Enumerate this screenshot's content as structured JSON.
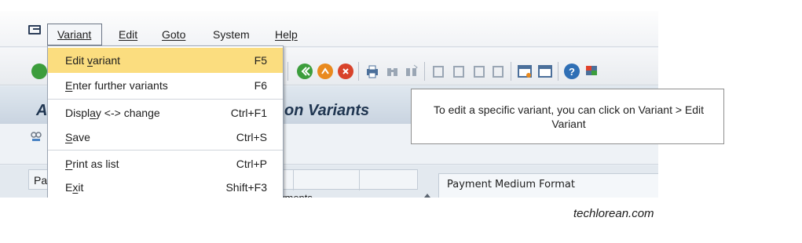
{
  "menubar": {
    "items": [
      {
        "label": "Variant"
      },
      {
        "label": "Edit"
      },
      {
        "label": "Goto"
      },
      {
        "label": "System"
      },
      {
        "label": "Help"
      }
    ]
  },
  "dropdown": {
    "items": [
      {
        "label_pre": "Edit ",
        "label_u": "v",
        "label_post": "ariant",
        "shortcut": "F5",
        "highlighted": true
      },
      {
        "label_pre": "",
        "label_u": "E",
        "label_post": "nter further variants",
        "shortcut": "F6"
      },
      {
        "label_pre": "Displ",
        "label_u": "a",
        "label_post": "y <-> change",
        "shortcut": "Ctrl+F1"
      },
      {
        "label_pre": "",
        "label_u": "S",
        "label_post": "ave",
        "shortcut": "Ctrl+S"
      },
      {
        "label_pre": "",
        "label_u": "P",
        "label_post": "rint as list",
        "shortcut": "Ctrl+P"
      },
      {
        "label_pre": "E",
        "label_u": "x",
        "label_post": "it",
        "shortcut": "Shift+F3"
      }
    ]
  },
  "page": {
    "title_visible": "on Variants",
    "title_first_letter": "A",
    "col_header_left": "Pa",
    "payments_partial": "yments",
    "payment_medium_format_label": "Payment Medium Format"
  },
  "callout": {
    "text": "To edit a specific variant, you can click on Variant > Edit Variant"
  },
  "watermark": "techlorean.com",
  "colors": {
    "highlight": "#fbdd7f",
    "title": "#1f3550",
    "green_check": "#3c9d3c",
    "orange_icon": "#e98a1e",
    "red_icon": "#d8432b"
  }
}
